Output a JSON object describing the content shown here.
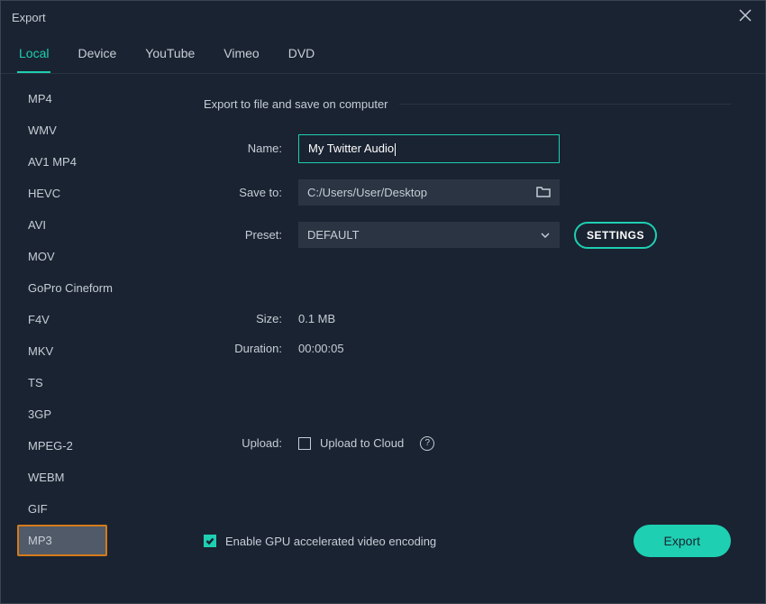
{
  "titlebar": {
    "title": "Export"
  },
  "tabs": [
    {
      "label": "Local",
      "active": true
    },
    {
      "label": "Device",
      "active": false
    },
    {
      "label": "YouTube",
      "active": false
    },
    {
      "label": "Vimeo",
      "active": false
    },
    {
      "label": "DVD",
      "active": false
    }
  ],
  "formats": [
    "MP4",
    "WMV",
    "AV1 MP4",
    "HEVC",
    "AVI",
    "MOV",
    "GoPro Cineform",
    "F4V",
    "MKV",
    "TS",
    "3GP",
    "MPEG-2",
    "WEBM",
    "GIF",
    "MP3"
  ],
  "selected_format": "MP3",
  "section_header": "Export to file and save on computer",
  "fields": {
    "name_label": "Name:",
    "name_value": "My Twitter Audio",
    "save_to_label": "Save to:",
    "save_to_value": "C:/Users/User/Desktop",
    "preset_label": "Preset:",
    "preset_value": "DEFAULT",
    "settings_label": "SETTINGS"
  },
  "info": {
    "size_label": "Size:",
    "size_value": "0.1 MB",
    "duration_label": "Duration:",
    "duration_value": "00:00:05"
  },
  "upload": {
    "label": "Upload:",
    "checkbox_label": "Upload to Cloud",
    "checked": false
  },
  "footer": {
    "gpu_label": "Enable GPU accelerated video encoding",
    "gpu_checked": true,
    "export_label": "Export"
  }
}
